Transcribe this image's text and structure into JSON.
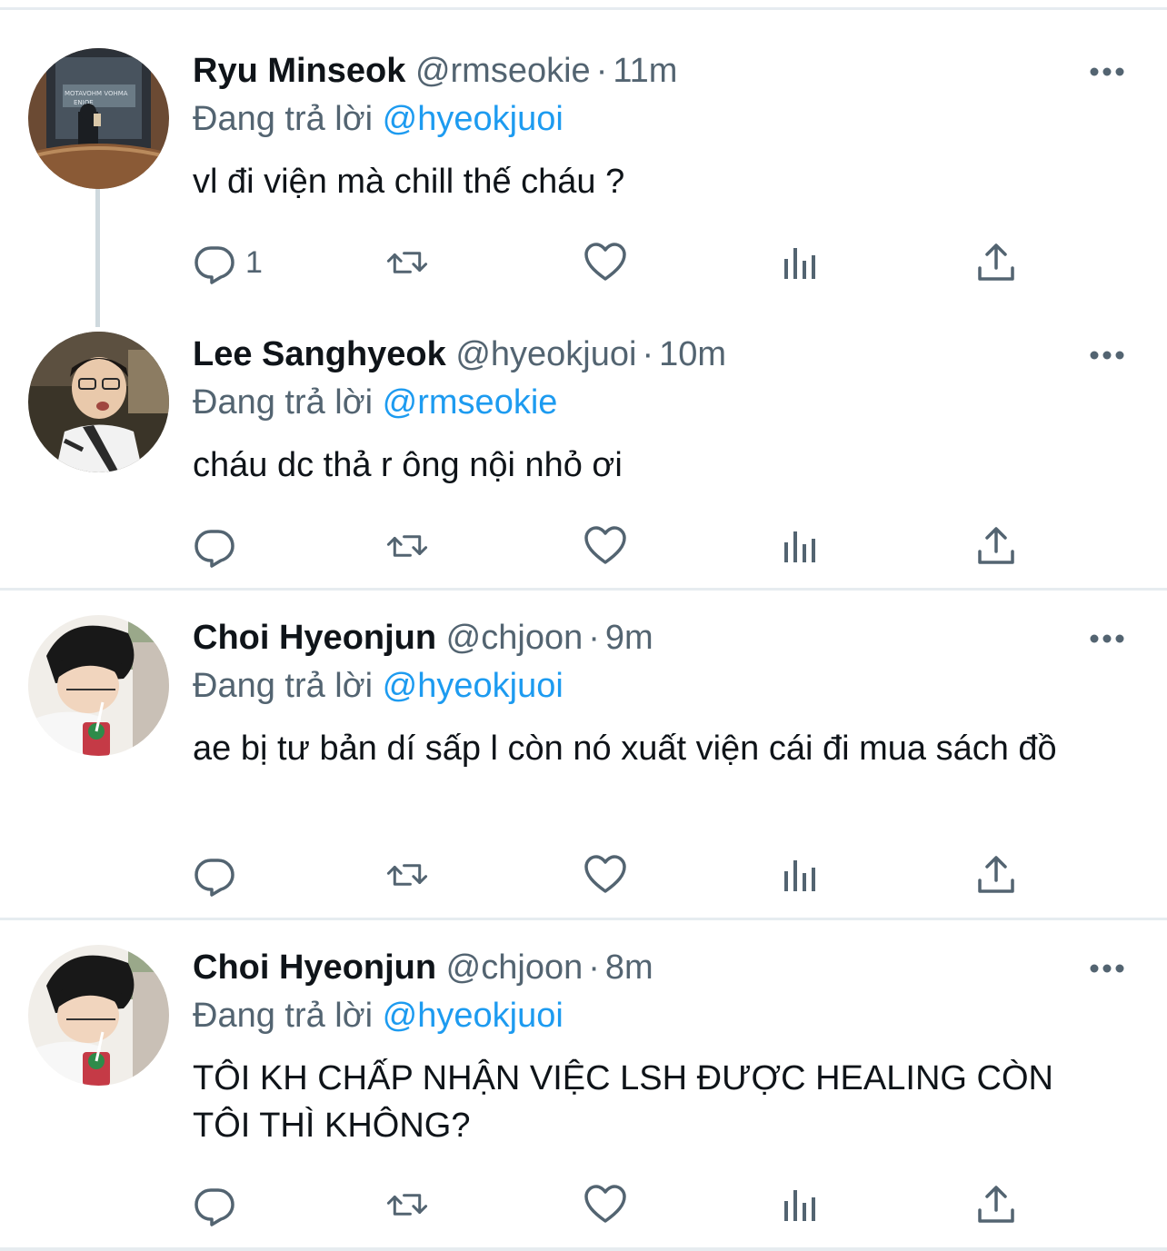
{
  "tweets": [
    {
      "name": "Ryu Minseok",
      "handle": "@rmseokie",
      "dot": "·",
      "time": "11m",
      "reply_prefix": "Đang trả lời",
      "reply_to": "@hyeokjuoi",
      "text": "vl đi viện mà chill thế cháu ?",
      "reply_count": "1",
      "avatar": "avatar-photo-elevator"
    },
    {
      "name": "Lee Sanghyeok",
      "handle": "@hyeokjuoi",
      "dot": "·",
      "time": "10m",
      "reply_prefix": "Đang trả lời",
      "reply_to": "@rmseokie",
      "text": "cháu dc thả r ông nội nhỏ ơi",
      "reply_count": "",
      "avatar": "avatar-photo-car"
    },
    {
      "name": "Choi Hyeonjun",
      "handle": "@chjoon",
      "dot": "·",
      "time": "9m",
      "reply_prefix": "Đang trả lời",
      "reply_to": "@hyeokjuoi",
      "text": "ae bị tư bản dí sấp l còn nó xuất viện cái đi mua sách đồ",
      "reply_count": "",
      "avatar": "avatar-photo-drink"
    },
    {
      "name": "Choi Hyeonjun",
      "handle": "@chjoon",
      "dot": "·",
      "time": "8m",
      "reply_prefix": "Đang trả lời",
      "reply_to": "@hyeokjuoi",
      "text": "TÔI KH CHẤP NHẬN VIỆC LSH ĐƯỢC HEALING CÒN TÔI THÌ KHÔNG?",
      "reply_count": "",
      "avatar": "avatar-photo-drink"
    }
  ],
  "icons": {
    "reply": "reply-icon",
    "retweet": "retweet-icon",
    "like": "heart-icon",
    "views": "analytics-icon",
    "share": "share-icon",
    "more": "more-options-icon"
  },
  "colors": {
    "link": "#1d9bf0",
    "muted": "#536471",
    "text": "#0f1419",
    "divider": "#e6ecf0"
  }
}
